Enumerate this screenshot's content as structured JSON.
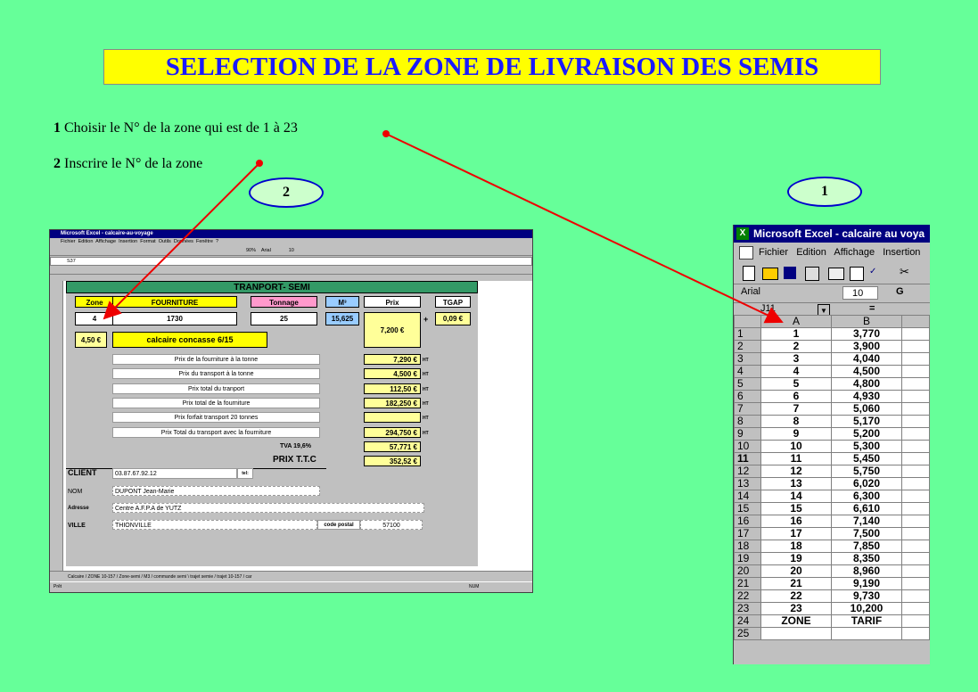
{
  "title": "SELECTION DE LA ZONE DE LIVRAISON DES SEMIS",
  "instructions": [
    {
      "num": "1",
      "text": "Choisir le N° de la zone qui est de 1 à 23"
    },
    {
      "num": "2",
      "text": "Inscrire le N° de la zone"
    }
  ],
  "ovals": [
    "2",
    "1"
  ],
  "left_excel": {
    "window_title": "Microsoft Excel - calcaire-au-voyage",
    "menu": [
      "Fichier",
      "Edition",
      "Affichage",
      "Insertion",
      "Format",
      "Outils",
      "Données",
      "Fenêtre",
      "?"
    ],
    "name_box": "S37",
    "zoom": "90%",
    "font": "Arial",
    "font_size": "10",
    "sheet_title": "TRANPORT- SEMI",
    "headers": {
      "zone": "Zone",
      "fourniture": "FOURNITURE",
      "tonnage": "Tonnage",
      "m3": "M³",
      "prix": "Prix",
      "tgap": "TGAP"
    },
    "values": {
      "zone": "4",
      "fourniture": "1730",
      "tonnage": "25",
      "m3": "15,625",
      "prix": "7,200 €",
      "tgap": "0,09 €",
      "price_left": "4,50 €",
      "material": "calcaire concasse  6/15",
      "plus": "+"
    },
    "lines": [
      {
        "label": "Prix de la fourniture à la tonne",
        "value": "7,290 €",
        "ht": "HT"
      },
      {
        "label": "Prix du transport à la tonne",
        "value": "4,500 €",
        "ht": "HT"
      },
      {
        "label": "Prix total du tranport",
        "value": "112,50 €",
        "ht": "HT"
      },
      {
        "label": "Prix total de la fourniture",
        "value": "182,250 €",
        "ht": "HT"
      },
      {
        "label": "Prix forfait transport 20 tonnes",
        "value": "",
        "ht": "HT"
      },
      {
        "label": "Prix Total du transport avec la fourniture",
        "value": "294,750 €",
        "ht": "HT"
      }
    ],
    "tva_label": "TVA 19,6%",
    "tva_value": "57,771 €",
    "ttc_label": "PRIX T.T.C",
    "ttc_value": "352,52 €",
    "client": {
      "label": "CLIENT",
      "phone": "03.87.67.92.12",
      "tel": "tel:",
      "nom_label": "NOM",
      "nom": "DUPONT Jean-Marie",
      "adresse_label": "Adresse",
      "adresse": "Centre A.F.P.A de YUTZ",
      "ville_label": "VILLE",
      "ville": "THIONVILLE",
      "cp_label": "code postal",
      "cp": "57100"
    },
    "tabs": "Calcaire / ZONE 10-157 / Zone-semi / M3 / commande semi \\ trajet semie / trajet 10-157 / car",
    "status_left": "Prêt",
    "status_right": "NUM"
  },
  "right_excel": {
    "window_title": "Microsoft Excel - calcaire au voya",
    "menu": [
      "Fichier",
      "Edition",
      "Affichage",
      "Insertion"
    ],
    "font": "Arial",
    "font_size": "10",
    "bold_btn": "G",
    "name_box": "J11",
    "eq": "=",
    "col_a": "A",
    "col_b": "B",
    "rows": [
      [
        "1",
        "1",
        "3,770"
      ],
      [
        "2",
        "2",
        "3,900"
      ],
      [
        "3",
        "3",
        "4,040"
      ],
      [
        "4",
        "4",
        "4,500"
      ],
      [
        "5",
        "5",
        "4,800"
      ],
      [
        "6",
        "6",
        "4,930"
      ],
      [
        "7",
        "7",
        "5,060"
      ],
      [
        "8",
        "8",
        "5,170"
      ],
      [
        "9",
        "9",
        "5,200"
      ],
      [
        "10",
        "10",
        "5,300"
      ],
      [
        "11",
        "11",
        "5,450"
      ],
      [
        "12",
        "12",
        "5,750"
      ],
      [
        "13",
        "13",
        "6,020"
      ],
      [
        "14",
        "14",
        "6,300"
      ],
      [
        "15",
        "15",
        "6,610"
      ],
      [
        "16",
        "16",
        "7,140"
      ],
      [
        "17",
        "17",
        "7,500"
      ],
      [
        "18",
        "18",
        "7,850"
      ],
      [
        "19",
        "19",
        "8,350"
      ],
      [
        "20",
        "20",
        "8,960"
      ],
      [
        "21",
        "21",
        "9,190"
      ],
      [
        "22",
        "22",
        "9,730"
      ],
      [
        "23",
        "23",
        "10,200"
      ],
      [
        "24",
        "ZONE",
        "TARIF"
      ],
      [
        "25",
        "",
        ""
      ]
    ]
  }
}
